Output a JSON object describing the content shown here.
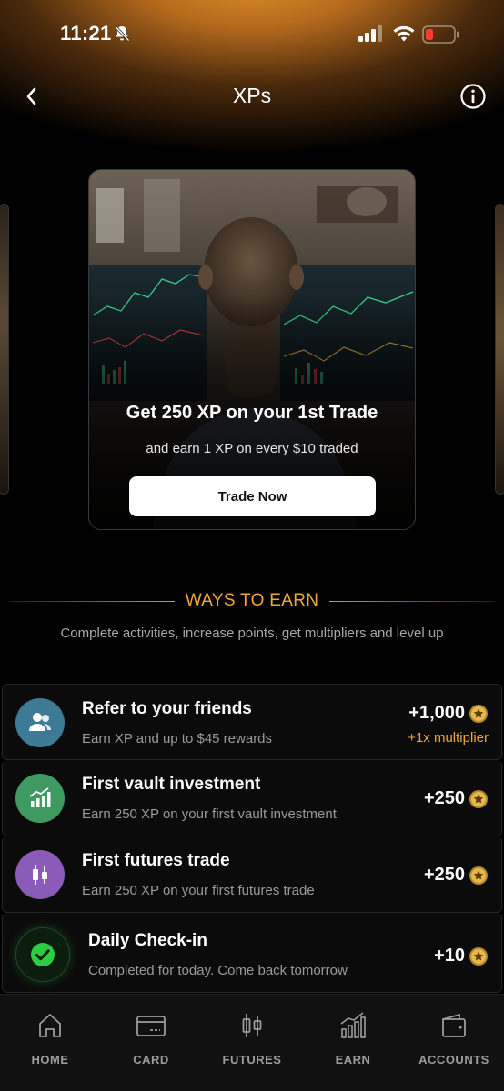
{
  "status_bar": {
    "time": "11:21"
  },
  "header": {
    "title": "XPs"
  },
  "promo": {
    "title": "Get 250 XP on your 1st Trade",
    "subtitle": "and earn 1 XP on every $10 traded",
    "button_label": "Trade Now"
  },
  "section": {
    "title": "WAYS TO EARN",
    "description": "Complete activities, increase points, get multipliers and level up"
  },
  "earn_items": [
    {
      "icon": "friends-icon",
      "color": "#3d7a95",
      "title": "Refer to your friends",
      "description": "Earn XP and up to $45 rewards",
      "points": "+1,000",
      "multiplier": "+1x multiplier"
    },
    {
      "icon": "chart-up-icon",
      "color": "#3f9a62",
      "title": "First vault investment",
      "description": "Earn 250 XP on your first vault investment",
      "points": "+250"
    },
    {
      "icon": "candlestick-icon",
      "color": "#8a5bb8",
      "title": "First futures trade",
      "description": "Earn 250 XP on your first futures trade",
      "points": "+250"
    },
    {
      "icon": "check-circle-icon",
      "color": "#2ecc40",
      "title": "Daily Check-in",
      "description": "Completed for today. Come back tomorrow",
      "points": "+10"
    }
  ],
  "tabs": [
    {
      "label": "HOME",
      "icon": "home-icon"
    },
    {
      "label": "CARD",
      "icon": "card-icon"
    },
    {
      "label": "FUTURES",
      "icon": "futures-icon"
    },
    {
      "label": "EARN",
      "icon": "earn-icon"
    },
    {
      "label": "ACCOUNTS",
      "icon": "wallet-icon"
    }
  ],
  "colors": {
    "accent": "#f0a63b",
    "background": "#000000",
    "glow": "#e0932c"
  }
}
